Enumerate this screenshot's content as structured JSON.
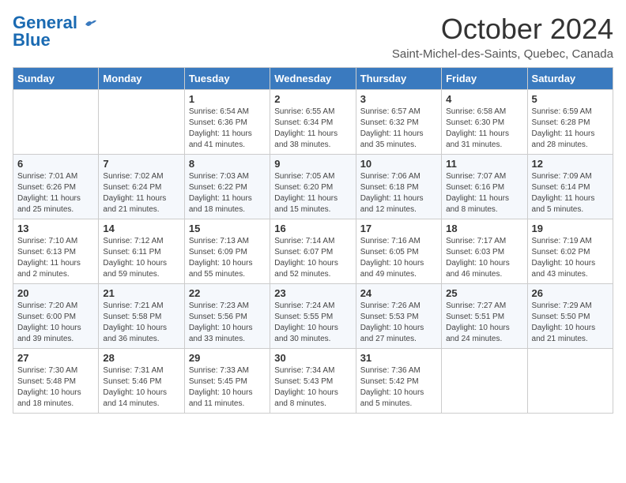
{
  "header": {
    "logo_line1": "General",
    "logo_line2": "Blue",
    "month": "October 2024",
    "location": "Saint-Michel-des-Saints, Quebec, Canada"
  },
  "days_of_week": [
    "Sunday",
    "Monday",
    "Tuesday",
    "Wednesday",
    "Thursday",
    "Friday",
    "Saturday"
  ],
  "weeks": [
    [
      {
        "day": "",
        "info": ""
      },
      {
        "day": "",
        "info": ""
      },
      {
        "day": "1",
        "info": "Sunrise: 6:54 AM\nSunset: 6:36 PM\nDaylight: 11 hours and 41 minutes."
      },
      {
        "day": "2",
        "info": "Sunrise: 6:55 AM\nSunset: 6:34 PM\nDaylight: 11 hours and 38 minutes."
      },
      {
        "day": "3",
        "info": "Sunrise: 6:57 AM\nSunset: 6:32 PM\nDaylight: 11 hours and 35 minutes."
      },
      {
        "day": "4",
        "info": "Sunrise: 6:58 AM\nSunset: 6:30 PM\nDaylight: 11 hours and 31 minutes."
      },
      {
        "day": "5",
        "info": "Sunrise: 6:59 AM\nSunset: 6:28 PM\nDaylight: 11 hours and 28 minutes."
      }
    ],
    [
      {
        "day": "6",
        "info": "Sunrise: 7:01 AM\nSunset: 6:26 PM\nDaylight: 11 hours and 25 minutes."
      },
      {
        "day": "7",
        "info": "Sunrise: 7:02 AM\nSunset: 6:24 PM\nDaylight: 11 hours and 21 minutes."
      },
      {
        "day": "8",
        "info": "Sunrise: 7:03 AM\nSunset: 6:22 PM\nDaylight: 11 hours and 18 minutes."
      },
      {
        "day": "9",
        "info": "Sunrise: 7:05 AM\nSunset: 6:20 PM\nDaylight: 11 hours and 15 minutes."
      },
      {
        "day": "10",
        "info": "Sunrise: 7:06 AM\nSunset: 6:18 PM\nDaylight: 11 hours and 12 minutes."
      },
      {
        "day": "11",
        "info": "Sunrise: 7:07 AM\nSunset: 6:16 PM\nDaylight: 11 hours and 8 minutes."
      },
      {
        "day": "12",
        "info": "Sunrise: 7:09 AM\nSunset: 6:14 PM\nDaylight: 11 hours and 5 minutes."
      }
    ],
    [
      {
        "day": "13",
        "info": "Sunrise: 7:10 AM\nSunset: 6:13 PM\nDaylight: 11 hours and 2 minutes."
      },
      {
        "day": "14",
        "info": "Sunrise: 7:12 AM\nSunset: 6:11 PM\nDaylight: 10 hours and 59 minutes."
      },
      {
        "day": "15",
        "info": "Sunrise: 7:13 AM\nSunset: 6:09 PM\nDaylight: 10 hours and 55 minutes."
      },
      {
        "day": "16",
        "info": "Sunrise: 7:14 AM\nSunset: 6:07 PM\nDaylight: 10 hours and 52 minutes."
      },
      {
        "day": "17",
        "info": "Sunrise: 7:16 AM\nSunset: 6:05 PM\nDaylight: 10 hours and 49 minutes."
      },
      {
        "day": "18",
        "info": "Sunrise: 7:17 AM\nSunset: 6:03 PM\nDaylight: 10 hours and 46 minutes."
      },
      {
        "day": "19",
        "info": "Sunrise: 7:19 AM\nSunset: 6:02 PM\nDaylight: 10 hours and 43 minutes."
      }
    ],
    [
      {
        "day": "20",
        "info": "Sunrise: 7:20 AM\nSunset: 6:00 PM\nDaylight: 10 hours and 39 minutes."
      },
      {
        "day": "21",
        "info": "Sunrise: 7:21 AM\nSunset: 5:58 PM\nDaylight: 10 hours and 36 minutes."
      },
      {
        "day": "22",
        "info": "Sunrise: 7:23 AM\nSunset: 5:56 PM\nDaylight: 10 hours and 33 minutes."
      },
      {
        "day": "23",
        "info": "Sunrise: 7:24 AM\nSunset: 5:55 PM\nDaylight: 10 hours and 30 minutes."
      },
      {
        "day": "24",
        "info": "Sunrise: 7:26 AM\nSunset: 5:53 PM\nDaylight: 10 hours and 27 minutes."
      },
      {
        "day": "25",
        "info": "Sunrise: 7:27 AM\nSunset: 5:51 PM\nDaylight: 10 hours and 24 minutes."
      },
      {
        "day": "26",
        "info": "Sunrise: 7:29 AM\nSunset: 5:50 PM\nDaylight: 10 hours and 21 minutes."
      }
    ],
    [
      {
        "day": "27",
        "info": "Sunrise: 7:30 AM\nSunset: 5:48 PM\nDaylight: 10 hours and 18 minutes."
      },
      {
        "day": "28",
        "info": "Sunrise: 7:31 AM\nSunset: 5:46 PM\nDaylight: 10 hours and 14 minutes."
      },
      {
        "day": "29",
        "info": "Sunrise: 7:33 AM\nSunset: 5:45 PM\nDaylight: 10 hours and 11 minutes."
      },
      {
        "day": "30",
        "info": "Sunrise: 7:34 AM\nSunset: 5:43 PM\nDaylight: 10 hours and 8 minutes."
      },
      {
        "day": "31",
        "info": "Sunrise: 7:36 AM\nSunset: 5:42 PM\nDaylight: 10 hours and 5 minutes."
      },
      {
        "day": "",
        "info": ""
      },
      {
        "day": "",
        "info": ""
      }
    ]
  ]
}
